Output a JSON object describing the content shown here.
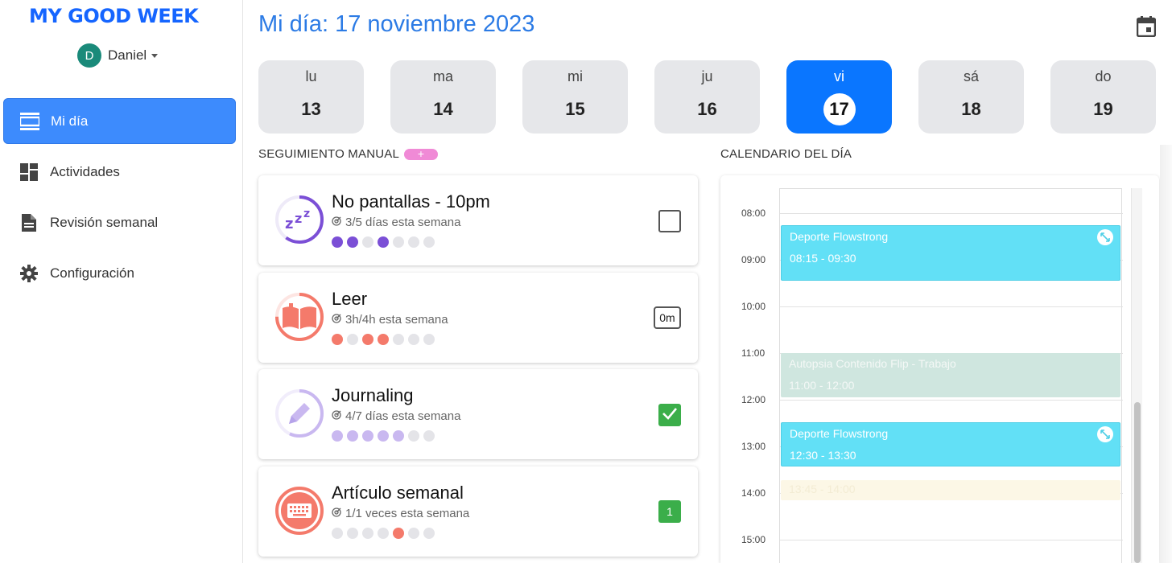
{
  "app": {
    "logo_text": "MY GOOD WEEK",
    "user": {
      "initial": "D",
      "name": "Daniel"
    }
  },
  "sidebar": {
    "items": [
      {
        "label": "Mi día",
        "icon": "view-day-icon",
        "active": true
      },
      {
        "label": "Actividades",
        "icon": "dashboard-icon",
        "active": false
      },
      {
        "label": "Revisión semanal",
        "icon": "document-icon",
        "active": false
      },
      {
        "label": "Configuración",
        "icon": "gear-icon",
        "active": false
      }
    ]
  },
  "header": {
    "title": "Mi día: 17 noviembre 2023",
    "calendar_icon": "calendar-icon"
  },
  "week": {
    "days": [
      {
        "name": "lu",
        "num": "13"
      },
      {
        "name": "ma",
        "num": "14"
      },
      {
        "name": "mi",
        "num": "15"
      },
      {
        "name": "ju",
        "num": "16"
      },
      {
        "name": "vi",
        "num": "17",
        "selected": true
      },
      {
        "name": "sá",
        "num": "18"
      },
      {
        "name": "do",
        "num": "19"
      }
    ]
  },
  "tracking": {
    "section_label": "SEGUIMIENTO MANUAL",
    "add_label": "+",
    "items": [
      {
        "title": "No pantallas - 10pm",
        "subtitle": "3/5 días esta semana",
        "progress": 0.6,
        "color": "#7b4fd6",
        "icon": "zzz-icon",
        "action": "checkbox-empty",
        "dots": [
          1,
          1,
          0,
          1,
          0,
          0,
          0
        ]
      },
      {
        "title": "Leer",
        "subtitle": "3h/4h esta semana",
        "progress": 0.75,
        "color": "#f47a6b",
        "icon": "book-icon",
        "action": "minutes",
        "action_label": "0m",
        "dots": [
          1,
          0,
          1,
          1,
          0,
          0,
          0
        ]
      },
      {
        "title": "Journaling",
        "subtitle": "4/7 días esta semana",
        "progress": 0.57,
        "color": "#c9b8f0",
        "icon": "pencil-icon",
        "action": "checkbox-done",
        "dots": [
          1,
          1,
          1,
          1,
          1,
          0,
          0
        ]
      },
      {
        "title": "Artículo semanal",
        "subtitle": "1/1 veces esta semana",
        "progress": 1.0,
        "color": "#f47a6b",
        "icon": "keyboard-icon",
        "action": "count",
        "action_label": "1",
        "dots": [
          0,
          0,
          0,
          0,
          1,
          0,
          0
        ]
      }
    ]
  },
  "calendar": {
    "section_label": "CALENDARIO DEL DÍA",
    "hours": [
      "08:00",
      "09:00",
      "10:00",
      "11:00",
      "12:00",
      "13:00",
      "14:00",
      "15:00"
    ],
    "events": [
      {
        "title": "Deporte Flowstrong",
        "time": "08:15 - 09:30",
        "style": "blue"
      },
      {
        "title": "Autopsia Contenido Flip - Trabajo",
        "time": "11:00 - 12:00",
        "style": "green"
      },
      {
        "title": "Deporte Flowstrong",
        "time": "12:30 - 13:30",
        "style": "blue"
      },
      {
        "title": "",
        "time": "13:45 - 14:00",
        "style": "yellow"
      }
    ]
  }
}
